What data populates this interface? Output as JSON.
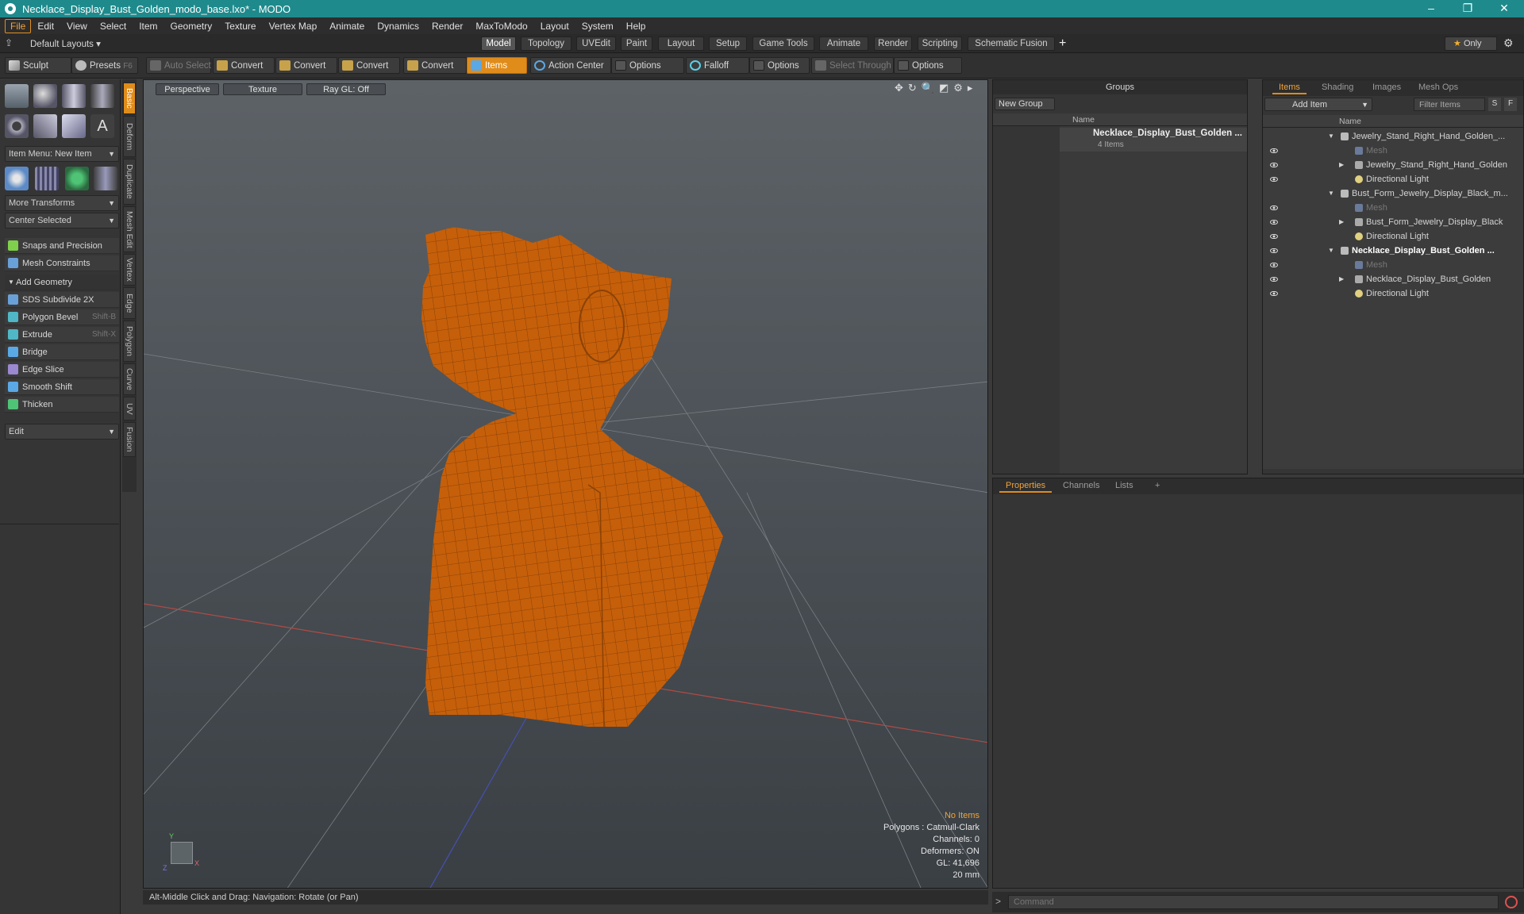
{
  "window": {
    "title": "Necklace_Display_Bust_Golden_modo_base.lxo* - MODO",
    "min": "–",
    "max": "❐",
    "close": "✕"
  },
  "menubar": {
    "items": [
      "File",
      "Edit",
      "View",
      "Select",
      "Item",
      "Geometry",
      "Texture",
      "Vertex Map",
      "Animate",
      "Dynamics",
      "Render",
      "MaxToModo",
      "Layout",
      "System",
      "Help"
    ]
  },
  "layoutbar": {
    "default_layouts": "Default Layouts ▾",
    "tabs": [
      "Model",
      "Topology",
      "UVEdit",
      "Paint",
      "Layout",
      "Setup",
      "Game Tools",
      "Animate",
      "Render",
      "Scripting",
      "Schematic Fusion"
    ],
    "add": "+",
    "only": "Only",
    "only_star": "★"
  },
  "toolbar": {
    "sculpt": "Sculpt",
    "presets": "Presets",
    "presets_key": "F6",
    "auto_select": "Auto Select",
    "convert1": "Convert",
    "convert2": "Convert",
    "convert3": "Convert",
    "convert4": "Convert",
    "items": "Items",
    "action_center": "Action Center",
    "options1": "Options",
    "falloff": "Falloff",
    "options2": "Options",
    "select_through": "Select Through",
    "options3": "Options"
  },
  "left": {
    "item_menu": "Item Menu: New Item",
    "more_transforms": "More Transforms",
    "center_selected": "Center Selected",
    "snaps": "Snaps and Precision",
    "mesh_constraints": "Mesh Constraints",
    "add_geometry": "Add Geometry",
    "tools": [
      {
        "label": "SDS Subdivide 2X",
        "key": ""
      },
      {
        "label": "Polygon Bevel",
        "key": "Shift-B"
      },
      {
        "label": "Extrude",
        "key": "Shift-X"
      },
      {
        "label": "Bridge",
        "key": ""
      },
      {
        "label": "Edge Slice",
        "key": ""
      },
      {
        "label": "Smooth Shift",
        "key": ""
      },
      {
        "label": "Thicken",
        "key": ""
      }
    ],
    "edit": "Edit",
    "vtabs": [
      "Basic",
      "Deform",
      "Duplicate",
      "Mesh Edit",
      "Vertex",
      "Edge",
      "Polygon",
      "Curve",
      "UV",
      "Fusion"
    ]
  },
  "viewport": {
    "tabs": [
      "Perspective",
      "Texture",
      "Ray GL: Off"
    ],
    "info": {
      "no_items": "No Items",
      "polygons": "Polygons : Catmull-Clark",
      "channels": "Channels: 0",
      "deformers": "Deformers: ON",
      "gl": "GL: 41,696",
      "size": "20 mm"
    },
    "axis_y": "Y",
    "axis_x": "X",
    "axis_z": "Z",
    "mesh_color": "#c65f0a"
  },
  "status": {
    "hint": "Alt-Middle Click and Drag:  Navigation: Rotate (or Pan)"
  },
  "groups": {
    "title": "Groups",
    "new_group": "New Group",
    "col_name": "Name",
    "group_name": "Necklace_Display_Bust_Golden ...",
    "group_count": "4 Items"
  },
  "items_panel": {
    "tabs": [
      "Items",
      "Shading",
      "Images",
      "Mesh Ops"
    ],
    "add_item": "Add Item",
    "filter": "Filter Items",
    "s": "S",
    "f": "F",
    "col_name": "Name",
    "rows": [
      {
        "label": "Jewelry_Stand_Right_Hand_Golden_...",
        "kind": "scene",
        "indent": 0,
        "bold": false,
        "dim": false,
        "eye": false
      },
      {
        "label": "Mesh",
        "kind": "mesh",
        "indent": 1,
        "bold": false,
        "dim": true,
        "eye": true
      },
      {
        "label": "Jewelry_Stand_Right_Hand_Golden",
        "kind": "group",
        "indent": 1,
        "bold": false,
        "dim": false,
        "eye": true
      },
      {
        "label": "Directional Light",
        "kind": "light",
        "indent": 1,
        "bold": false,
        "dim": false,
        "eye": true
      },
      {
        "label": "Bust_Form_Jewelry_Display_Black_m...",
        "kind": "scene",
        "indent": 0,
        "bold": false,
        "dim": false,
        "eye": false
      },
      {
        "label": "Mesh",
        "kind": "mesh",
        "indent": 1,
        "bold": false,
        "dim": true,
        "eye": true
      },
      {
        "label": "Bust_Form_Jewelry_Display_Black",
        "kind": "group",
        "indent": 1,
        "bold": false,
        "dim": false,
        "eye": true
      },
      {
        "label": "Directional Light",
        "kind": "light",
        "indent": 1,
        "bold": false,
        "dim": false,
        "eye": true
      },
      {
        "label": "Necklace_Display_Bust_Golden ...",
        "kind": "scene",
        "indent": 0,
        "bold": true,
        "dim": false,
        "eye": true
      },
      {
        "label": "Mesh",
        "kind": "mesh",
        "indent": 1,
        "bold": false,
        "dim": true,
        "eye": true
      },
      {
        "label": "Necklace_Display_Bust_Golden",
        "kind": "group",
        "indent": 1,
        "bold": false,
        "dim": false,
        "eye": true
      },
      {
        "label": "Directional Light",
        "kind": "light",
        "indent": 1,
        "bold": false,
        "dim": false,
        "eye": true
      }
    ]
  },
  "properties": {
    "tabs": [
      "Properties",
      "Channels",
      "Lists"
    ],
    "add": "+"
  },
  "command": {
    "placeholder": "Command",
    "prompt": ">"
  }
}
